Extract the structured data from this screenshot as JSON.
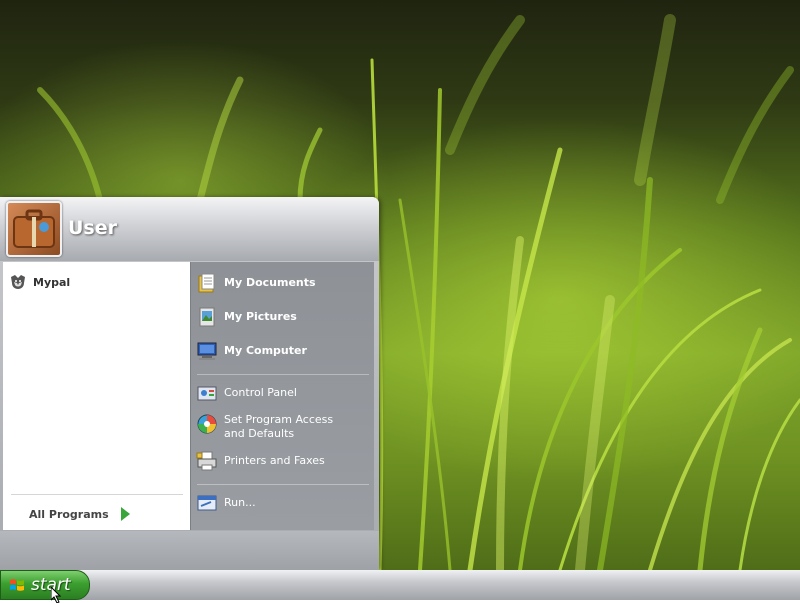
{
  "start_menu": {
    "user_name": "User",
    "pinned": [
      {
        "label": "Mypal",
        "icon": "mypal-browser-icon"
      }
    ],
    "all_programs_label": "All Programs",
    "places": [
      {
        "label": "My Documents",
        "icon": "my-documents-icon"
      },
      {
        "label": "My Pictures",
        "icon": "my-pictures-icon"
      },
      {
        "label": "My Computer",
        "icon": "my-computer-icon"
      }
    ],
    "system": [
      {
        "label": "Control Panel",
        "icon": "control-panel-icon"
      },
      {
        "label": "Set Program Access and Defaults",
        "icon": "program-defaults-icon"
      },
      {
        "label": "Printers and Faxes",
        "icon": "printer-icon"
      }
    ],
    "run_label": "Run..."
  },
  "taskbar": {
    "start_label": "start"
  },
  "colors": {
    "start_green": "#3b9f2f",
    "all_programs_arrow": "#39a53a"
  }
}
